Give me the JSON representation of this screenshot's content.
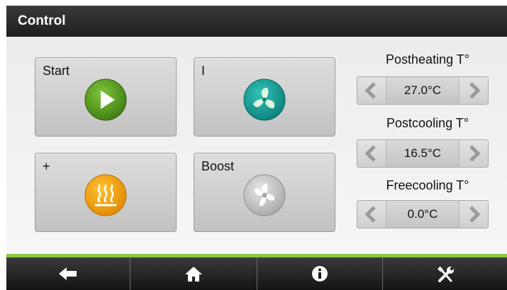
{
  "header": {
    "title": "Control"
  },
  "tiles": {
    "start": {
      "label": "Start",
      "icon": "play-icon",
      "color": "#5a9e1e"
    },
    "speed": {
      "label": "I",
      "icon": "fan-icon",
      "color": "#14a39a"
    },
    "heat": {
      "label": "+",
      "icon": "heating-icon",
      "color": "#f2a100"
    },
    "boost": {
      "label": "Boost",
      "icon": "fan-icon",
      "color": "#c8c8c8"
    }
  },
  "controls": [
    {
      "label": "Postheating T°",
      "value": "27.0°C"
    },
    {
      "label": "Postcooling T°",
      "value": "16.5°C"
    },
    {
      "label": "Freecooling T°",
      "value": "0.0°C"
    }
  ],
  "nav": [
    {
      "icon": "back-arrow-icon"
    },
    {
      "icon": "home-icon"
    },
    {
      "icon": "info-icon"
    },
    {
      "icon": "tools-icon"
    }
  ],
  "accent_color": "#8dc63f"
}
